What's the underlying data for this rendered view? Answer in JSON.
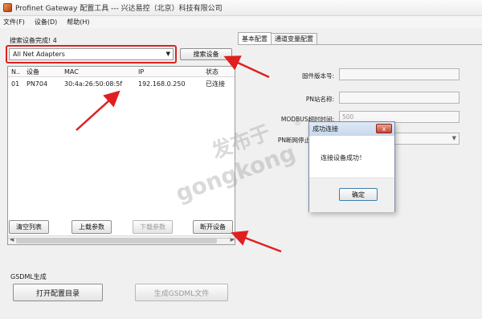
{
  "window": {
    "title": "Profinet Gateway 配置工具 --- 兴达易控（北京）科技有限公司"
  },
  "menu": {
    "file": "文件(F)",
    "device": "设备(D)",
    "help": "帮助(H)"
  },
  "left": {
    "status": "搜索设备完成! 4",
    "adapter": "All Net Adapters",
    "search_button": "搜索设备",
    "table": {
      "headers": [
        "N..",
        "设备",
        "MAC",
        "IP",
        "状态"
      ],
      "rows": [
        [
          "01",
          "PN704",
          "30:4a:26:50:08:5f",
          "192.168.0.250",
          "已连接"
        ]
      ]
    },
    "buttons": {
      "clear": "清空列表",
      "upload": "上载参数",
      "download": "下载参数",
      "disconnect": "断开设备"
    },
    "gsdml": {
      "title": "GSDML生成",
      "open": "打开配置目录",
      "generate": "生成GSDML文件"
    }
  },
  "right": {
    "tabs": [
      "基本配置",
      "通道变量配置"
    ],
    "fields": {
      "firmware_label": "固件版本号:",
      "pn_name_label": "PN站名称:",
      "modbus_label": "MODBUS超时时间:",
      "modbus_value": "500",
      "pn_stop_label": "PN断网停止发送命令"
    }
  },
  "dialog": {
    "title": "成功连接",
    "message": "连接设备成功！",
    "ok": "确定",
    "close": "x"
  },
  "watermark": {
    "line1": "发布于",
    "line2": "gongkong",
    "mark": "®"
  },
  "accent": {
    "red": "#e02020"
  }
}
